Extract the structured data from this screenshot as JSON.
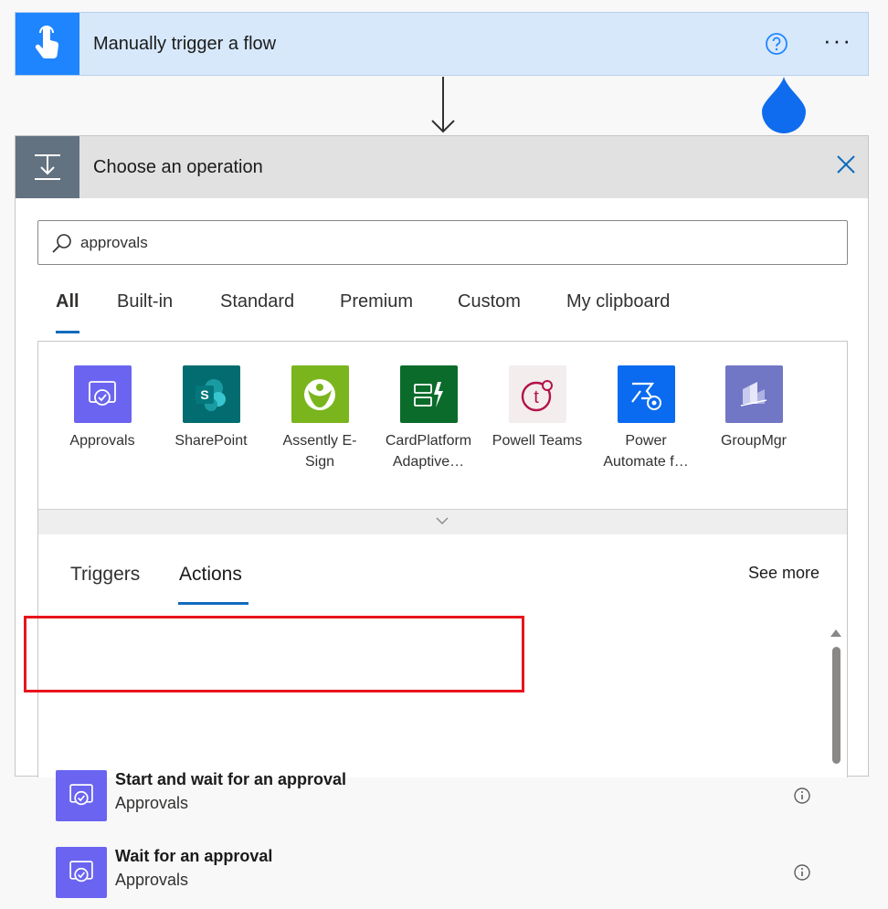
{
  "trigger": {
    "title": "Manually trigger a flow",
    "more_label": "···",
    "accent": "#1f85ff"
  },
  "operation": {
    "title": "Choose an operation",
    "search": {
      "value": "approvals"
    },
    "categories": [
      "All",
      "Built-in",
      "Standard",
      "Premium",
      "Custom",
      "My clipboard"
    ],
    "selected_category": "All",
    "connectors": [
      {
        "line1": "Approvals",
        "line2": "",
        "icon": "approvals-icon",
        "color": "#6a64f0"
      },
      {
        "line1": "SharePoint",
        "line2": "",
        "icon": "sharepoint-icon",
        "color": "#036c70"
      },
      {
        "line1": "Assently E-",
        "line2": "Sign",
        "icon": "assently-icon",
        "color": "#7ab51d"
      },
      {
        "line1": "CardPlatform",
        "line2": "Adaptive…",
        "icon": "cardplatform-icon",
        "color": "#0b6b2b"
      },
      {
        "line1": "Powell Teams",
        "line2": "",
        "icon": "powell-teams-icon",
        "color": "#f3eded"
      },
      {
        "line1": "Power",
        "line2": "Automate f…",
        "icon": "power-automate-icon",
        "color": "#0a6bf0"
      },
      {
        "line1": "GroupMgr",
        "line2": "",
        "icon": "groupmgr-icon",
        "color": "#7177c5"
      }
    ],
    "subtabs": [
      "Triggers",
      "Actions"
    ],
    "selected_subtab": "Actions",
    "see_more": "See more",
    "actions": [
      {
        "title": "Start and wait for an approval",
        "connector": "Approvals",
        "highlighted": true
      },
      {
        "title": "Wait for an approval",
        "connector": "Approvals",
        "highlighted": false
      }
    ]
  }
}
